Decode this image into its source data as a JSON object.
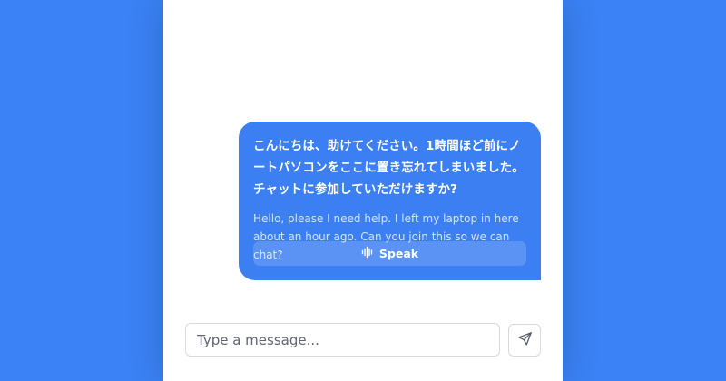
{
  "colors": {
    "background": "#3b82f6",
    "panel": "#ffffff",
    "bubble": "#3b7ff2",
    "border": "#d6d9de",
    "text_muted": "#5f6470"
  },
  "message": {
    "original_text": "こんにちは、助けてください。1時間ほど前にノートパソコンをここに置き忘れてしまいました。チャットに参加していただけますか?",
    "translation_text": "Hello, please I need help. I left my laptop in here about an hour ago. Can you join this so we can chat?",
    "speak_label": "Speak",
    "speak_icon": "audio-waveform-icon"
  },
  "composer": {
    "placeholder": "Type a message...",
    "value": "",
    "send_icon": "send-icon"
  }
}
